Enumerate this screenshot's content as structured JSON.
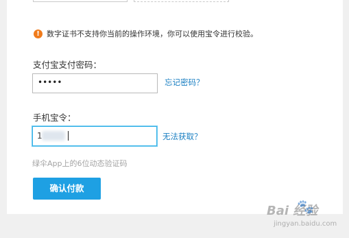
{
  "warning": {
    "icon": "exclamation-icon",
    "icon_glyph": "!",
    "text": "数字证书不支持你当前的操作环境，你可以使用宝令进行校验。"
  },
  "password": {
    "label": "支付宝支付密码：",
    "value_masked": "•••••",
    "forgot_link": "忘记密码？"
  },
  "token": {
    "label": "手机宝令：",
    "value_prefix": "1",
    "unavailable_link": "无法获取？",
    "hint": "绿伞App上的6位动态验证码"
  },
  "actions": {
    "confirm_label": "确认付款"
  },
  "watermark": {
    "main": "Bai   经验",
    "sub": "jingyan.baidu.com"
  },
  "colors": {
    "accent": "#1ea0e3",
    "link": "#1a7fc2",
    "warning": "#f07b1b",
    "focus_border": "#38b3e8"
  }
}
